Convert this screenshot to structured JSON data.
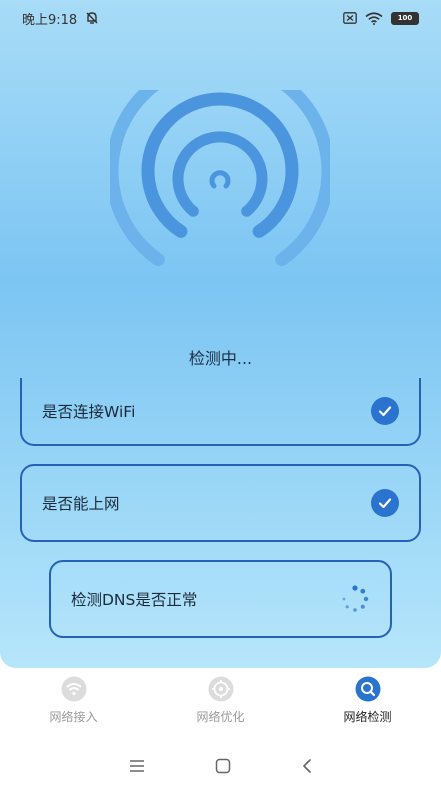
{
  "status_bar": {
    "time": "晚上9:18",
    "battery": "100"
  },
  "main": {
    "checking_text": "检测中...",
    "checks": [
      {
        "label": "是否连接WiFi",
        "state": "done"
      },
      {
        "label": "是否能上网",
        "state": "done"
      },
      {
        "label": "检测DNS是否正常",
        "state": "loading"
      }
    ]
  },
  "nav": {
    "items": [
      {
        "label": "网络接入",
        "icon": "wifi-icon",
        "active": false
      },
      {
        "label": "网络优化",
        "icon": "optimize-icon",
        "active": false
      },
      {
        "label": "网络检测",
        "icon": "search-icon",
        "active": true
      }
    ]
  },
  "colors": {
    "accent": "#2a73cf",
    "card_border": "#2462b8"
  }
}
